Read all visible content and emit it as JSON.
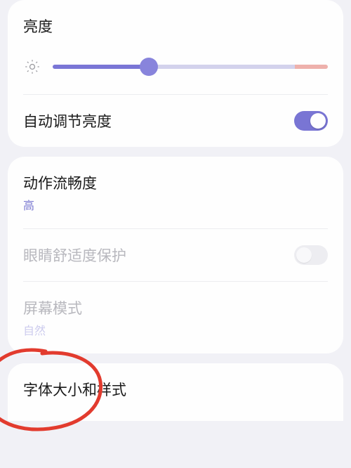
{
  "brightness": {
    "title": "亮度",
    "slider_percent": 35
  },
  "auto_brightness": {
    "label": "自动调节亮度",
    "enabled": true
  },
  "motion_smoothness": {
    "label": "动作流畅度",
    "value": "高"
  },
  "eye_comfort": {
    "label": "眼睛舒适度保护",
    "enabled": false,
    "disabled_state": true
  },
  "screen_mode": {
    "label": "屏幕模式",
    "value": "自然",
    "disabled_state": true
  },
  "font_size_style": {
    "label": "字体大小和样式"
  },
  "colors": {
    "accent": "#7975d4",
    "track_warn": "#eeb1ac"
  }
}
